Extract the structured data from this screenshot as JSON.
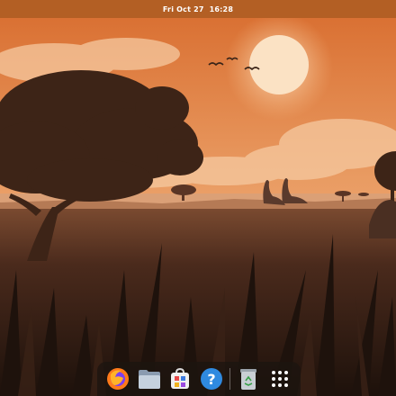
{
  "topbar": {
    "date": "Fri Oct 27",
    "time": "16:28"
  },
  "dock": {
    "apps": [
      {
        "name": "Firefox",
        "icon": "firefox-icon"
      },
      {
        "name": "Files",
        "icon": "files-icon"
      },
      {
        "name": "Software",
        "icon": "software-store-icon"
      },
      {
        "name": "Help",
        "icon": "help-icon"
      },
      {
        "name": "Trash",
        "icon": "trash-icon"
      },
      {
        "name": "Show Applications",
        "icon": "app-grid-icon"
      }
    ]
  },
  "colors": {
    "topbar": "#b35f24",
    "sky_top": "#e07a3c",
    "sky_horizon": "#f3b98a",
    "sun": "#fbe2c4",
    "grass_dark": "#2a1810"
  }
}
